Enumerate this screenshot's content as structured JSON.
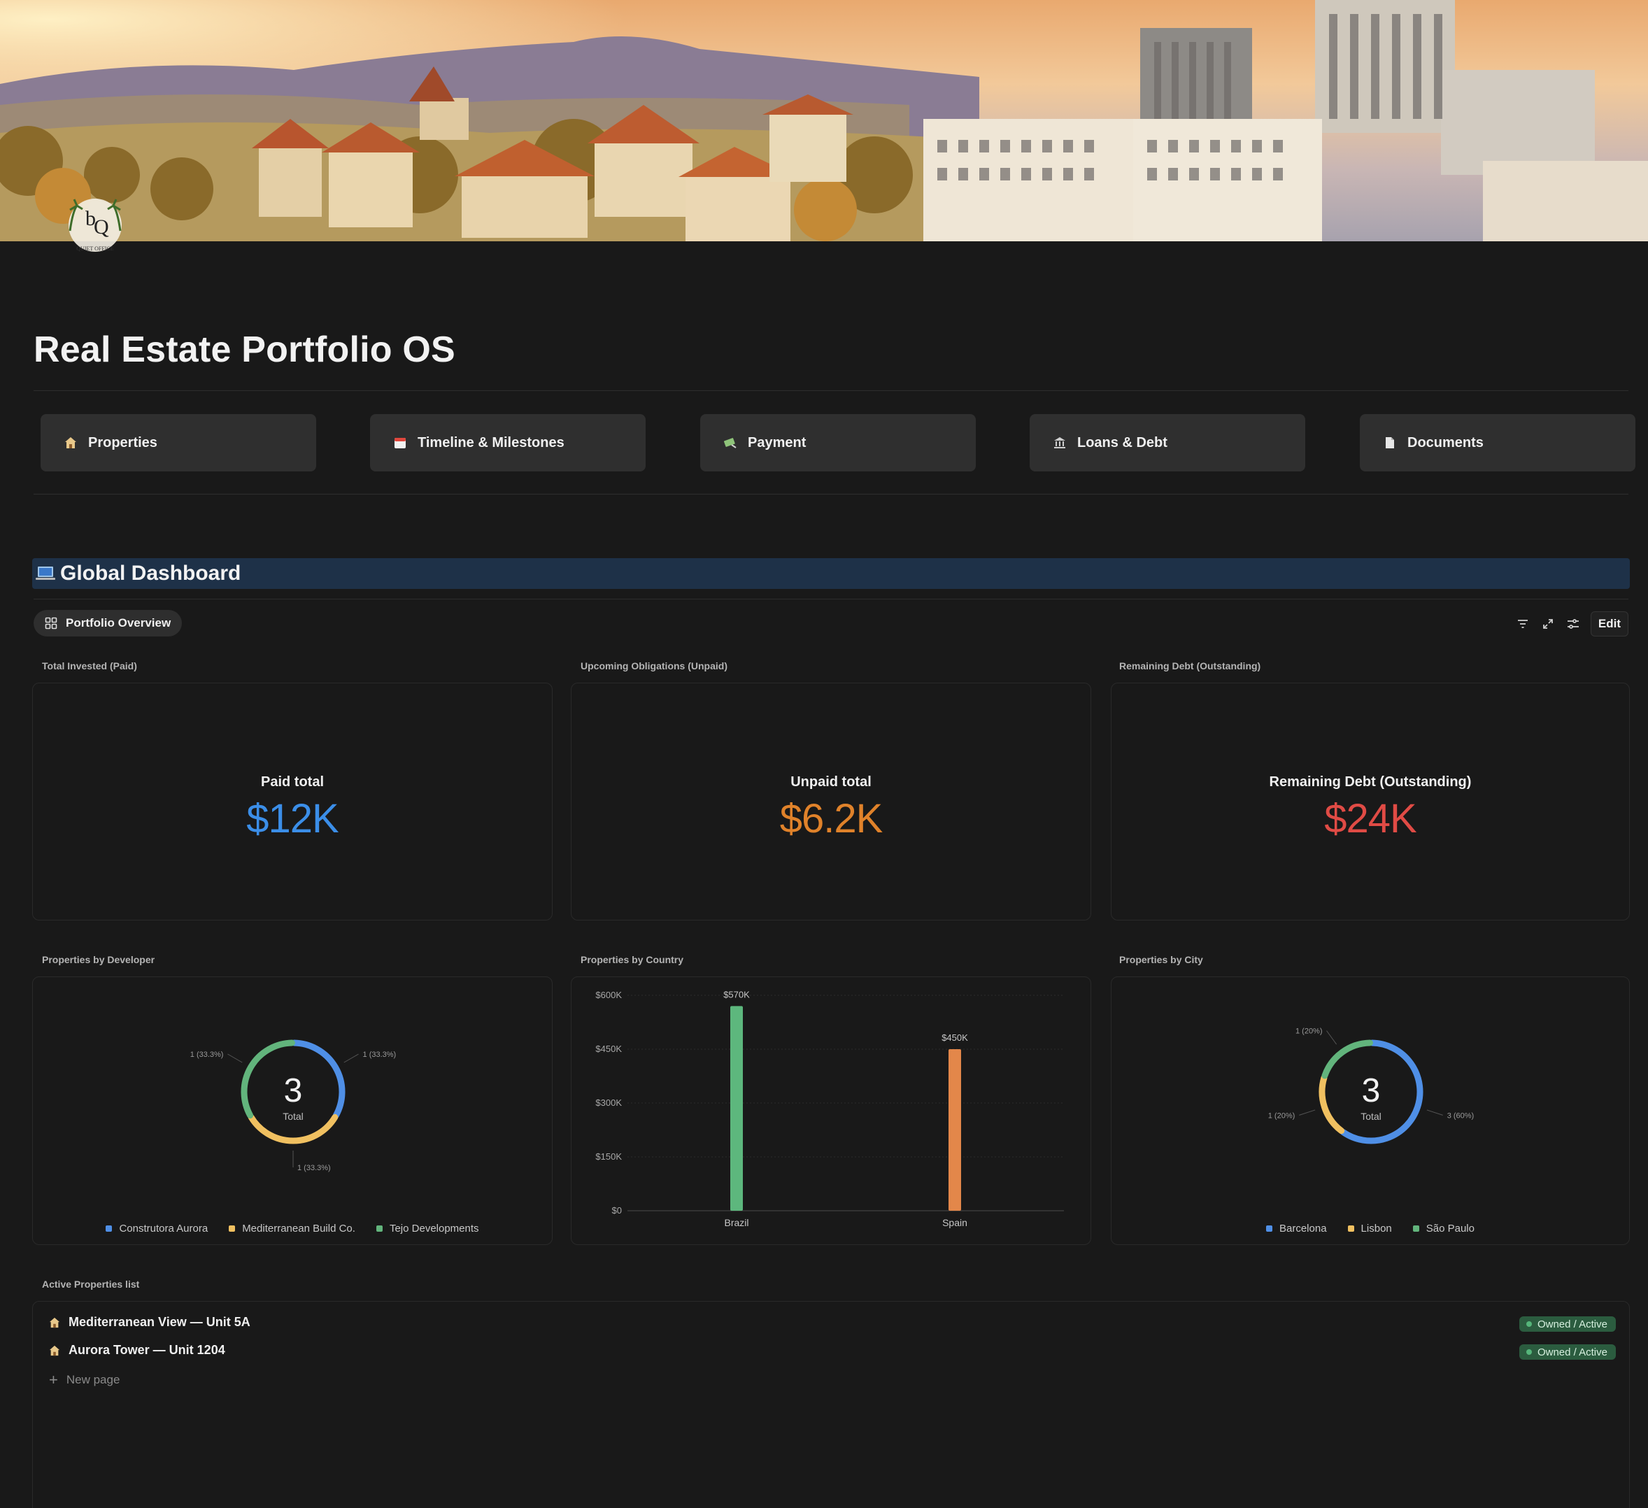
{
  "banner": {
    "logo_text": "QUIET OFFICE"
  },
  "page_title": "Real Estate Portfolio OS",
  "nav": [
    {
      "label": "Properties",
      "icon": "house-icon"
    },
    {
      "label": "Timeline & Milestones",
      "icon": "calendar-icon"
    },
    {
      "label": "Payment",
      "icon": "money-icon"
    },
    {
      "label": "Loans & Debt",
      "icon": "bank-icon"
    },
    {
      "label": "Documents",
      "icon": "document-icon"
    }
  ],
  "dashboard": {
    "heading": "Global Dashboard",
    "view_tab": "Portfolio Overview",
    "edit_label": "Edit"
  },
  "metrics": [
    {
      "label": "Total Invested (Paid)",
      "title": "Paid total",
      "value": "$12K",
      "color": "#3b8ee8"
    },
    {
      "label": "Upcoming Obligations (Unpaid)",
      "title": "Unpaid total",
      "value": "$6.2K",
      "color": "#e0822a"
    },
    {
      "label": "Remaining Debt (Outstanding)",
      "title": "Remaining Debt (Outstanding)",
      "value": "$24K",
      "color": "#e04b45"
    }
  ],
  "charts": {
    "developer_label": "Properties by Developer",
    "country_label": "Properties by Country",
    "city_label": "Properties by City"
  },
  "chart_data": [
    {
      "type": "pie",
      "title": "Properties by Developer",
      "center_value": "3",
      "center_label": "Total",
      "categories": [
        "Construtora Aurora",
        "Mediterranean Build Co.",
        "Tejo Developments"
      ],
      "values": [
        1,
        1,
        1
      ],
      "slice_labels": [
        "1 (33.3%)",
        "1 (33.3%)",
        "1 (33.3%)"
      ],
      "colors": [
        "#4f8fe6",
        "#f0c060",
        "#62b47c"
      ],
      "legend": "bottom"
    },
    {
      "type": "bar",
      "title": "Properties by Country",
      "categories": [
        "Brazil",
        "Spain"
      ],
      "values": [
        570000,
        450000
      ],
      "value_labels": [
        "$570K",
        "$450K"
      ],
      "colors": [
        "#5db77d",
        "#e3874a"
      ],
      "ylim": [
        0,
        600000
      ],
      "yticks": [
        "$0",
        "$150K",
        "$300K",
        "$450K",
        "$600K"
      ],
      "grid": true
    },
    {
      "type": "pie",
      "title": "Properties by City",
      "center_value": "3",
      "center_label": "Total",
      "categories": [
        "Barcelona",
        "Lisbon",
        "São Paulo"
      ],
      "values": [
        3,
        1,
        1
      ],
      "slice_labels": [
        "3 (60%)",
        "1 (20%)",
        "1 (20%)"
      ],
      "colors": [
        "#4f8fe6",
        "#f0c060",
        "#62b47c"
      ],
      "legend": "bottom"
    }
  ],
  "active_list": {
    "label": "Active Properties list",
    "rows": [
      {
        "name": "Mediterranean View — Unit 5A",
        "status": "Owned / Active"
      },
      {
        "name": "Aurora Tower — Unit 1204",
        "status": "Owned / Active"
      }
    ],
    "new_page": "New page"
  }
}
